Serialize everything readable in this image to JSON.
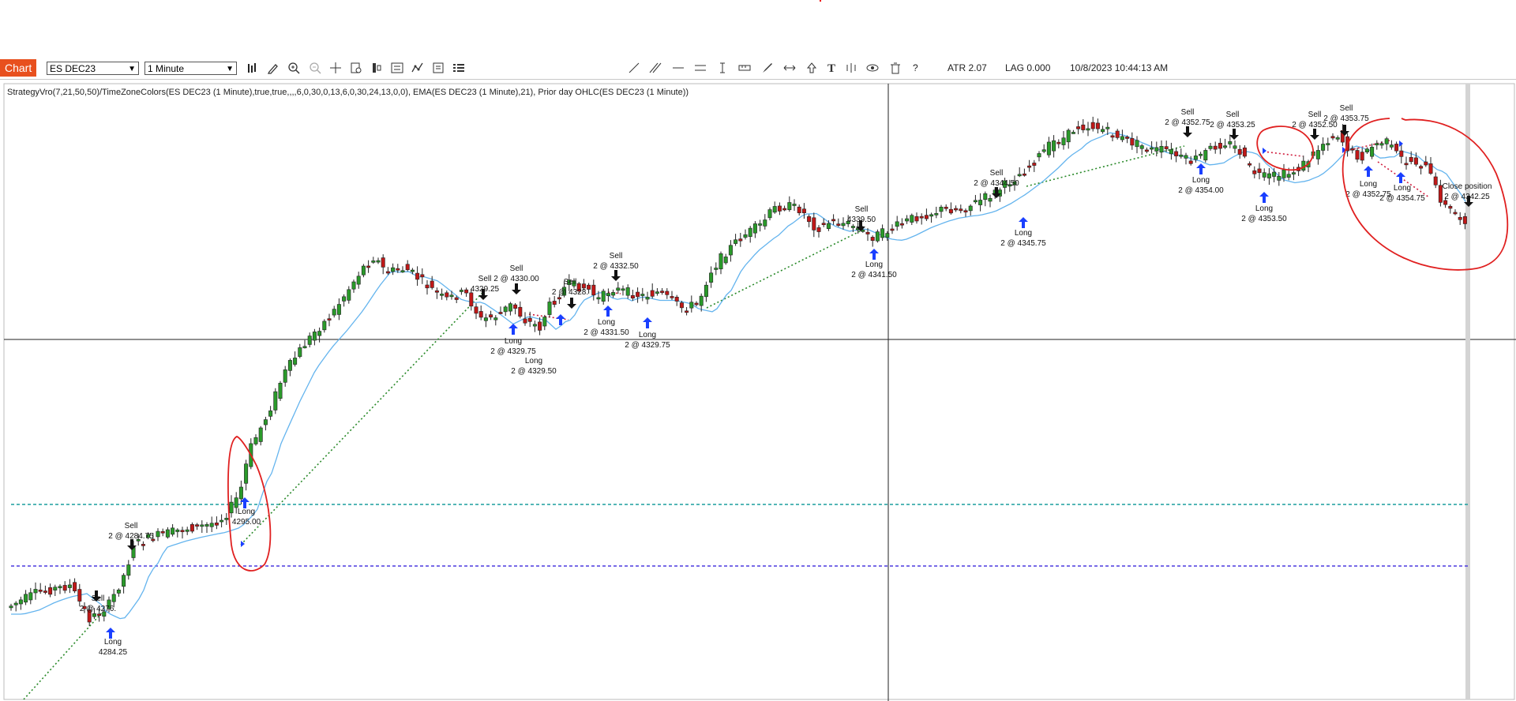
{
  "toolbar": {
    "chart_tab": "Chart",
    "instrument": "ES DEC23",
    "interval": "1 Minute",
    "atr": "ATR 2.07",
    "lag": "LAG 0.000",
    "timestamp": "10/8/2023 10:44:13 AM",
    "help": "?",
    "left_icons": [
      "bar-type-icon",
      "pencil-icon",
      "zoom-in-icon",
      "zoom-out-icon",
      "crosshair-icon",
      "data-box-icon",
      "strategies-icon",
      "properties-icon",
      "indicators-icon",
      "templates-icon",
      "menu-icon"
    ],
    "right_icons": [
      "line-icon",
      "ray-icon",
      "horizontal-line-icon",
      "double-line-icon",
      "text-cursor-icon",
      "ruler-icon",
      "brush-icon",
      "expand-icon",
      "arrow-up-icon",
      "text-icon",
      "fib-icon",
      "eye-icon",
      "trash-icon"
    ]
  },
  "indicator_label": "StrategyVro(7,21,50,50)/TimeZoneColors(ES DEC23 (1 Minute),true,true,,,,6,0,30,0,13,6,0,30,24,13,0,0), EMA(ES DEC23 (1 Minute),21), Prior day OHLC(ES DEC23 (1 Minute))",
  "colors": {
    "bull": "#2a9a2a",
    "bear": "#c01818",
    "ema": "#64b4ee",
    "teal_line": "#1a9e9e",
    "purple_line": "#4b3adf",
    "circle": "#e02020",
    "arrow_long": "#1a3fff",
    "arrow_short": "#111111"
  },
  "trades": [
    {
      "side": "Sell",
      "qty_price": "2 @ 4276.00",
      "label_display": "2 @ 4276."
    },
    {
      "side": "Long",
      "qty_price": "2 @ 4284.25",
      "label_display": "4284.25"
    },
    {
      "side": "Sell",
      "qty_price": "2 @ 4284.75"
    },
    {
      "side": "Long",
      "qty_price": "2 @ 4295.00",
      "label_display": "4295.00"
    },
    {
      "side": "Sell",
      "qty_price": "4329.25"
    },
    {
      "side": "Sell",
      "qty_price": "2 @ 4330.00"
    },
    {
      "side": "Long",
      "qty_price": "2 @ 4329.75"
    },
    {
      "side": "Long",
      "qty_price": "2 @ 4329.50"
    },
    {
      "side": "Sell",
      "qty_price": "2 @ 4328.",
      "label_display": "2 @ 4328."
    },
    {
      "side": "Sell",
      "qty_price": "2 @ 4332.50"
    },
    {
      "side": "Long",
      "qty_price": "2 @ 4331.50"
    },
    {
      "side": "Long",
      "qty_price": "2 @ 4329.75"
    },
    {
      "side": "Sell",
      "qty_price": "2 @ 4339.50",
      "label_display": "4339.50"
    },
    {
      "side": "Long",
      "qty_price": "2 @ 4341.50"
    },
    {
      "side": "Sell",
      "qty_price": "2 @ 4344.50"
    },
    {
      "side": "Long",
      "qty_price": "2 @ 4345.75"
    },
    {
      "side": "Sell",
      "qty_price": "2 @ 4352.75"
    },
    {
      "side": "Sell",
      "qty_price": "2 @ 4353.25"
    },
    {
      "side": "Long",
      "qty_price": "2 @ 4354.00"
    },
    {
      "side": "Long",
      "qty_price": "2 @ 4353.50"
    },
    {
      "side": "Sell",
      "qty_price": "2 @ 4352.50"
    },
    {
      "side": "Sell",
      "qty_price": "2 @ 4353.75"
    },
    {
      "side": "Long",
      "qty_price": "2 @ 4352.75"
    },
    {
      "side": "Long",
      "qty_price": "2 @ 4354.75"
    },
    {
      "side": "Close position",
      "qty_price": "2 @ 4342.25"
    }
  ]
}
